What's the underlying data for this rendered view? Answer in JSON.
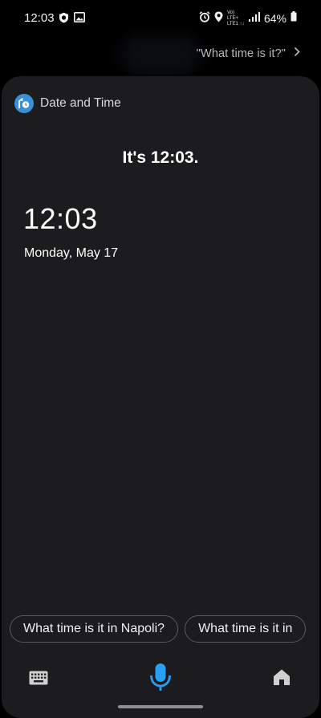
{
  "status_bar": {
    "time": "12:03",
    "network_top": "Vo) LTE+",
    "network_bottom": "LTE1 ↑↓",
    "battery": "64%",
    "left_icons": [
      "shield-icon",
      "image-icon"
    ],
    "right_icons": [
      "alarm-icon",
      "location-icon",
      "signal-icon",
      "battery-icon"
    ]
  },
  "query": {
    "text": "\"What time is it?\""
  },
  "card": {
    "title": "Date and Time",
    "answer": "It's 12:03.",
    "clock_time": "12:03",
    "clock_date": "Monday, May 17"
  },
  "suggestions": [
    {
      "label": "What time is it in Napoli?"
    },
    {
      "label": "What time is it in"
    }
  ],
  "bottom_bar": {
    "icons": [
      "keyboard-icon",
      "microphone-icon",
      "home-icon"
    ]
  },
  "colors": {
    "accent": "#2a9df4",
    "card_background": "#1c1c1e",
    "page_background": "#000000"
  }
}
